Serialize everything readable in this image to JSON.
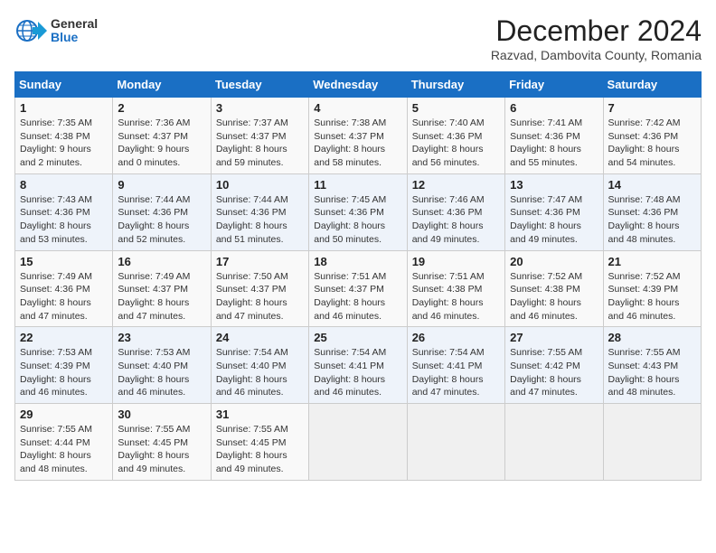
{
  "header": {
    "logo_general": "General",
    "logo_blue": "Blue",
    "title": "December 2024",
    "subtitle": "Razvad, Dambovita County, Romania"
  },
  "days_of_week": [
    "Sunday",
    "Monday",
    "Tuesday",
    "Wednesday",
    "Thursday",
    "Friday",
    "Saturday"
  ],
  "weeks": [
    [
      {
        "num": "1",
        "sunrise": "7:35 AM",
        "sunset": "4:38 PM",
        "daylight": "9 hours and 2 minutes."
      },
      {
        "num": "2",
        "sunrise": "7:36 AM",
        "sunset": "4:37 PM",
        "daylight": "9 hours and 0 minutes."
      },
      {
        "num": "3",
        "sunrise": "7:37 AM",
        "sunset": "4:37 PM",
        "daylight": "8 hours and 59 minutes."
      },
      {
        "num": "4",
        "sunrise": "7:38 AM",
        "sunset": "4:37 PM",
        "daylight": "8 hours and 58 minutes."
      },
      {
        "num": "5",
        "sunrise": "7:40 AM",
        "sunset": "4:36 PM",
        "daylight": "8 hours and 56 minutes."
      },
      {
        "num": "6",
        "sunrise": "7:41 AM",
        "sunset": "4:36 PM",
        "daylight": "8 hours and 55 minutes."
      },
      {
        "num": "7",
        "sunrise": "7:42 AM",
        "sunset": "4:36 PM",
        "daylight": "8 hours and 54 minutes."
      }
    ],
    [
      {
        "num": "8",
        "sunrise": "7:43 AM",
        "sunset": "4:36 PM",
        "daylight": "8 hours and 53 minutes."
      },
      {
        "num": "9",
        "sunrise": "7:44 AM",
        "sunset": "4:36 PM",
        "daylight": "8 hours and 52 minutes."
      },
      {
        "num": "10",
        "sunrise": "7:44 AM",
        "sunset": "4:36 PM",
        "daylight": "8 hours and 51 minutes."
      },
      {
        "num": "11",
        "sunrise": "7:45 AM",
        "sunset": "4:36 PM",
        "daylight": "8 hours and 50 minutes."
      },
      {
        "num": "12",
        "sunrise": "7:46 AM",
        "sunset": "4:36 PM",
        "daylight": "8 hours and 49 minutes."
      },
      {
        "num": "13",
        "sunrise": "7:47 AM",
        "sunset": "4:36 PM",
        "daylight": "8 hours and 49 minutes."
      },
      {
        "num": "14",
        "sunrise": "7:48 AM",
        "sunset": "4:36 PM",
        "daylight": "8 hours and 48 minutes."
      }
    ],
    [
      {
        "num": "15",
        "sunrise": "7:49 AM",
        "sunset": "4:36 PM",
        "daylight": "8 hours and 47 minutes."
      },
      {
        "num": "16",
        "sunrise": "7:49 AM",
        "sunset": "4:37 PM",
        "daylight": "8 hours and 47 minutes."
      },
      {
        "num": "17",
        "sunrise": "7:50 AM",
        "sunset": "4:37 PM",
        "daylight": "8 hours and 47 minutes."
      },
      {
        "num": "18",
        "sunrise": "7:51 AM",
        "sunset": "4:37 PM",
        "daylight": "8 hours and 46 minutes."
      },
      {
        "num": "19",
        "sunrise": "7:51 AM",
        "sunset": "4:38 PM",
        "daylight": "8 hours and 46 minutes."
      },
      {
        "num": "20",
        "sunrise": "7:52 AM",
        "sunset": "4:38 PM",
        "daylight": "8 hours and 46 minutes."
      },
      {
        "num": "21",
        "sunrise": "7:52 AM",
        "sunset": "4:39 PM",
        "daylight": "8 hours and 46 minutes."
      }
    ],
    [
      {
        "num": "22",
        "sunrise": "7:53 AM",
        "sunset": "4:39 PM",
        "daylight": "8 hours and 46 minutes."
      },
      {
        "num": "23",
        "sunrise": "7:53 AM",
        "sunset": "4:40 PM",
        "daylight": "8 hours and 46 minutes."
      },
      {
        "num": "24",
        "sunrise": "7:54 AM",
        "sunset": "4:40 PM",
        "daylight": "8 hours and 46 minutes."
      },
      {
        "num": "25",
        "sunrise": "7:54 AM",
        "sunset": "4:41 PM",
        "daylight": "8 hours and 46 minutes."
      },
      {
        "num": "26",
        "sunrise": "7:54 AM",
        "sunset": "4:41 PM",
        "daylight": "8 hours and 47 minutes."
      },
      {
        "num": "27",
        "sunrise": "7:55 AM",
        "sunset": "4:42 PM",
        "daylight": "8 hours and 47 minutes."
      },
      {
        "num": "28",
        "sunrise": "7:55 AM",
        "sunset": "4:43 PM",
        "daylight": "8 hours and 48 minutes."
      }
    ],
    [
      {
        "num": "29",
        "sunrise": "7:55 AM",
        "sunset": "4:44 PM",
        "daylight": "8 hours and 48 minutes."
      },
      {
        "num": "30",
        "sunrise": "7:55 AM",
        "sunset": "4:45 PM",
        "daylight": "8 hours and 49 minutes."
      },
      {
        "num": "31",
        "sunrise": "7:55 AM",
        "sunset": "4:45 PM",
        "daylight": "8 hours and 49 minutes."
      },
      null,
      null,
      null,
      null
    ]
  ]
}
